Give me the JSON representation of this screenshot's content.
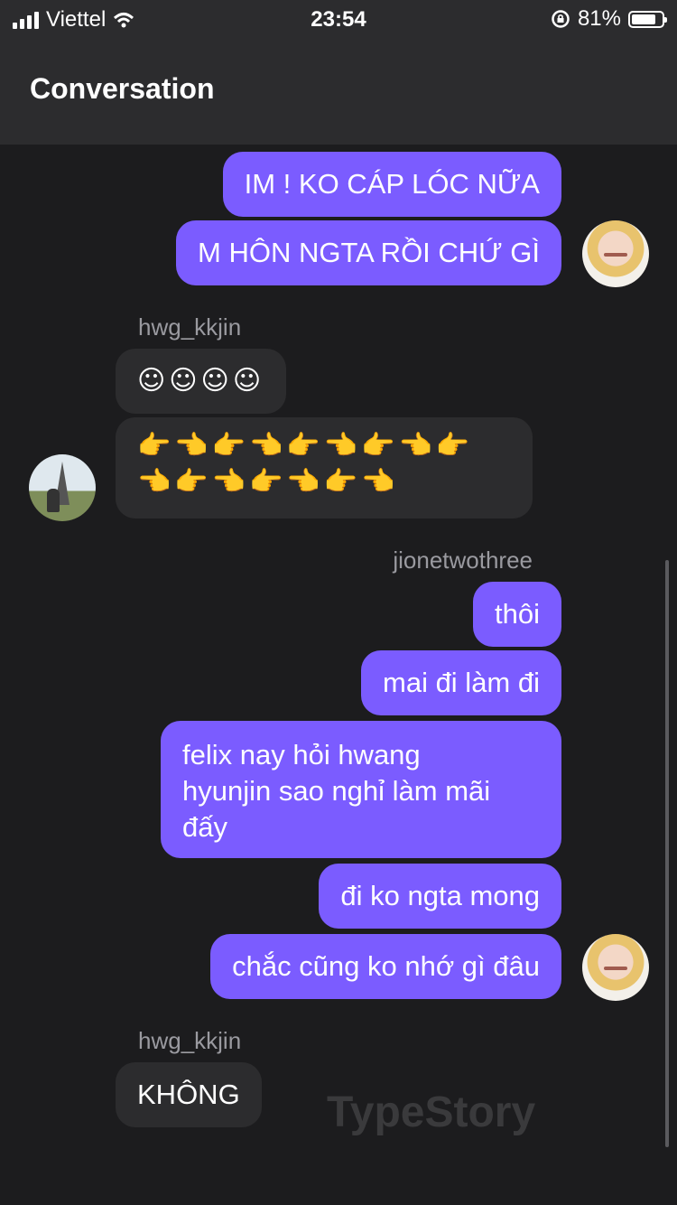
{
  "status": {
    "carrier": "Viettel",
    "time": "23:54",
    "battery": "81%",
    "battery_level": 0.81
  },
  "header": {
    "title": "Conversation"
  },
  "messages": {
    "m1": "IM ! KO CÁP LÓC NỮA",
    "m2": "M HÔN NGTA RỒI CHỨ GÌ",
    "user1": "hwg_kkjin",
    "m3": "☺☺☺☺",
    "m4a": "👉👈👉👈👉👈👉👈👉",
    "m4b": "👈👉👈👉👈👉👈",
    "user2": "jionetwothree",
    "m5": "thôi",
    "m6": "mai đi làm đi",
    "m7a": "felix nay hỏi hwang",
    "m7b": "hyunjin sao nghỉ làm mãi",
    "m7c": "đấy",
    "m8": "đi ko ngta mong",
    "m9": "chắc cũng ko nhớ gì đâu",
    "user3": "hwg_kkjin",
    "m10": "KHÔNG"
  },
  "watermark": "TypeStory",
  "colors": {
    "sent_bubble": "#7b5cff",
    "recv_bubble": "#2c2c2e",
    "background": "#1c1c1e"
  }
}
